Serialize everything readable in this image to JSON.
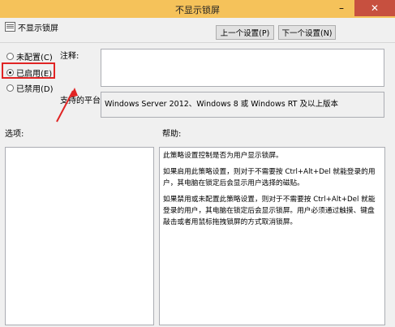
{
  "window": {
    "title": "不显示锁屏",
    "minimize_glyph": "–",
    "close_glyph": "✕"
  },
  "header": {
    "subtitle": "不显示锁屏",
    "prev_button": "上一个设置(P)",
    "next_button": "下一个设置(N)"
  },
  "state": {
    "options": [
      {
        "label": "未配置(C)",
        "checked": false
      },
      {
        "label": "已启用(E)",
        "checked": true
      },
      {
        "label": "已禁用(D)",
        "checked": false
      }
    ]
  },
  "comment": {
    "label": "注释:",
    "value": ""
  },
  "platform": {
    "label": "支持的平台:",
    "value": "Windows Server 2012、Windows 8 或 Windows RT 及以上版本"
  },
  "options_section": {
    "label": "选项:"
  },
  "help_section": {
    "label": "帮助:",
    "paragraphs": [
      "此策略设置控制是否为用户显示锁屏。",
      "如果启用此策略设置，则对于不需要按 Ctrl+Alt+Del 就能登录的用户，其电脑在锁定后会显示用户选择的磁贴。",
      "如果禁用或未配置此策略设置，则对于不需要按 Ctrl+Alt+Del 就能登录的用户，其电脑在锁定后会显示锁屏。用户必须通过触摸、键盘敲击或者用鼠标拖拽锁屏的方式取消锁屏。"
    ]
  },
  "colors": {
    "titlebar": "#f5c25a",
    "close": "#c7503f",
    "annotation": "#e02424"
  }
}
